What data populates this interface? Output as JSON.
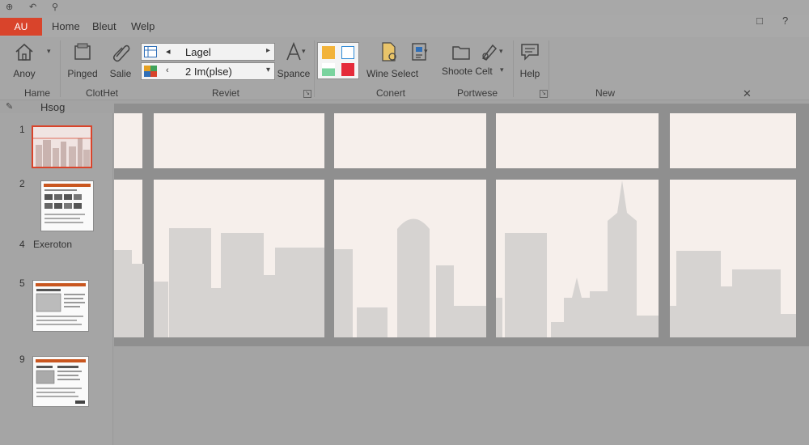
{
  "quick_access": {
    "icon1": "save-icon",
    "icon2": "undo-icon",
    "icon3": "pin-icon"
  },
  "tabs": {
    "file": "AU",
    "items": [
      "Home",
      "Bleut",
      "Welp"
    ]
  },
  "window_controls": {
    "restore": "□",
    "help": "?"
  },
  "ribbon": {
    "anoy": "Anoy",
    "pinged": "Pinged",
    "salie": "Salie",
    "combo1": {
      "text": "Lagel"
    },
    "combo2": {
      "prefix": "2",
      "text": "2 Im(plse)"
    },
    "spance": "Spance",
    "wine_select": "Wine Select",
    "shoote_celt": "Shoote Celt",
    "help": "Help",
    "groups": {
      "hame": "Hame",
      "clothet": "ClotHet",
      "reviet": "Reviet",
      "conert": "Conert",
      "portwese": "Portwese",
      "new": "New"
    },
    "colors": {
      "orange": "#f2b33a",
      "green": "#7ad39e",
      "red": "#e52b3a",
      "blue_outline": "#2f8ad6"
    }
  },
  "pane_header": {
    "title": "Hsog",
    "close": "✕"
  },
  "thumbnails": [
    {
      "number": "1",
      "selected": true
    },
    {
      "number": "2"
    },
    {
      "number": "4",
      "label": "Exeroton"
    },
    {
      "number": "5"
    },
    {
      "number": "9"
    }
  ],
  "accent_color": "#d9442b"
}
